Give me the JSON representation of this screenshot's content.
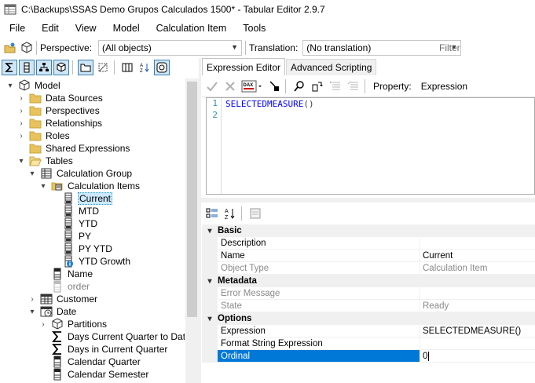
{
  "window": {
    "title": "C:\\Backups\\SSAS Demo Grupos Calculados 1500* - Tabular Editor 2.9.7"
  },
  "menu": [
    "File",
    "Edit",
    "View",
    "Model",
    "Calculation Item",
    "Tools"
  ],
  "toolbar": {
    "perspective_label": "Perspective:",
    "perspective_value": "(All objects)",
    "translation_label": "Translation:",
    "translation_value": "(No translation)",
    "filter_placeholder": "Filter"
  },
  "tree": [
    {
      "label": "Model",
      "icon": "model-icon",
      "expander": "open",
      "level": 0
    },
    {
      "label": "Data Sources",
      "icon": "folder-icon",
      "expander": "closed",
      "level": 1
    },
    {
      "label": "Perspectives",
      "icon": "folder-icon",
      "expander": "closed",
      "level": 1
    },
    {
      "label": "Relationships",
      "icon": "folder-icon",
      "expander": "closed",
      "level": 1
    },
    {
      "label": "Roles",
      "icon": "folder-icon",
      "expander": "closed",
      "level": 1
    },
    {
      "label": "Shared Expressions",
      "icon": "folder-icon",
      "expander": "none",
      "level": 1
    },
    {
      "label": "Tables",
      "icon": "folder-open-icon",
      "expander": "open",
      "level": 1
    },
    {
      "label": "Calculation Group",
      "icon": "calc-group-icon",
      "expander": "open",
      "level": 2
    },
    {
      "label": "Calculation Items",
      "icon": "calc-items-folder-icon",
      "expander": "open",
      "level": 3
    },
    {
      "label": "Current",
      "icon": "calc-item-icon",
      "expander": "none",
      "level": 4,
      "selected": true
    },
    {
      "label": "MTD",
      "icon": "calc-item-icon",
      "expander": "none",
      "level": 4
    },
    {
      "label": "YTD",
      "icon": "calc-item-icon",
      "expander": "none",
      "level": 4
    },
    {
      "label": "PY",
      "icon": "calc-item-icon",
      "expander": "none",
      "level": 4
    },
    {
      "label": "PY YTD",
      "icon": "calc-item-icon",
      "expander": "none",
      "level": 4
    },
    {
      "label": "YTD Growth",
      "icon": "calc-item-info-icon",
      "expander": "none",
      "level": 4
    },
    {
      "label": "Name",
      "icon": "column-icon",
      "expander": "none",
      "level": 3
    },
    {
      "label": "order",
      "icon": "hidden-column-icon",
      "expander": "none",
      "level": 3,
      "gray": true
    },
    {
      "label": "Customer",
      "icon": "table-icon",
      "expander": "closed",
      "level": 2
    },
    {
      "label": "Date",
      "icon": "date-table-icon",
      "expander": "open",
      "level": 2
    },
    {
      "label": "Partitions",
      "icon": "partitions-icon",
      "expander": "closed",
      "level": 3
    },
    {
      "label": "Days Current Quarter to Date",
      "icon": "measure-icon",
      "expander": "none",
      "level": 3
    },
    {
      "label": "Days in Current Quarter",
      "icon": "measure-icon",
      "expander": "none",
      "level": 3
    },
    {
      "label": "Calendar Quarter",
      "icon": "column-icon",
      "expander": "none",
      "level": 3
    },
    {
      "label": "Calendar Semester",
      "icon": "column-icon",
      "expander": "none",
      "level": 3
    }
  ],
  "tabs": [
    "Expression Editor",
    "Advanced Scripting"
  ],
  "editor": {
    "property_label": "Property:",
    "property_value": "Expression",
    "line_numbers": [
      "1",
      "2"
    ],
    "code": "SELECTEDMEASURE",
    "code_parens": "()"
  },
  "property_grid": [
    {
      "type": "category",
      "label": "Basic"
    },
    {
      "type": "prop",
      "name": "Description",
      "value": ""
    },
    {
      "type": "prop",
      "name": "Name",
      "value": "Current"
    },
    {
      "type": "prop",
      "name": "Object Type",
      "value": "Calculation Item",
      "readonly": true
    },
    {
      "type": "category",
      "label": "Metadata"
    },
    {
      "type": "prop",
      "name": "Error Message",
      "value": "",
      "readonly": true
    },
    {
      "type": "prop",
      "name": "State",
      "value": "Ready",
      "readonly": true
    },
    {
      "type": "category",
      "label": "Options"
    },
    {
      "type": "prop",
      "name": "Expression",
      "value": "SELECTEDMEASURE()"
    },
    {
      "type": "prop",
      "name": "Format String Expression",
      "value": ""
    },
    {
      "type": "prop",
      "name": "Ordinal",
      "value": "0",
      "selected": true
    }
  ]
}
